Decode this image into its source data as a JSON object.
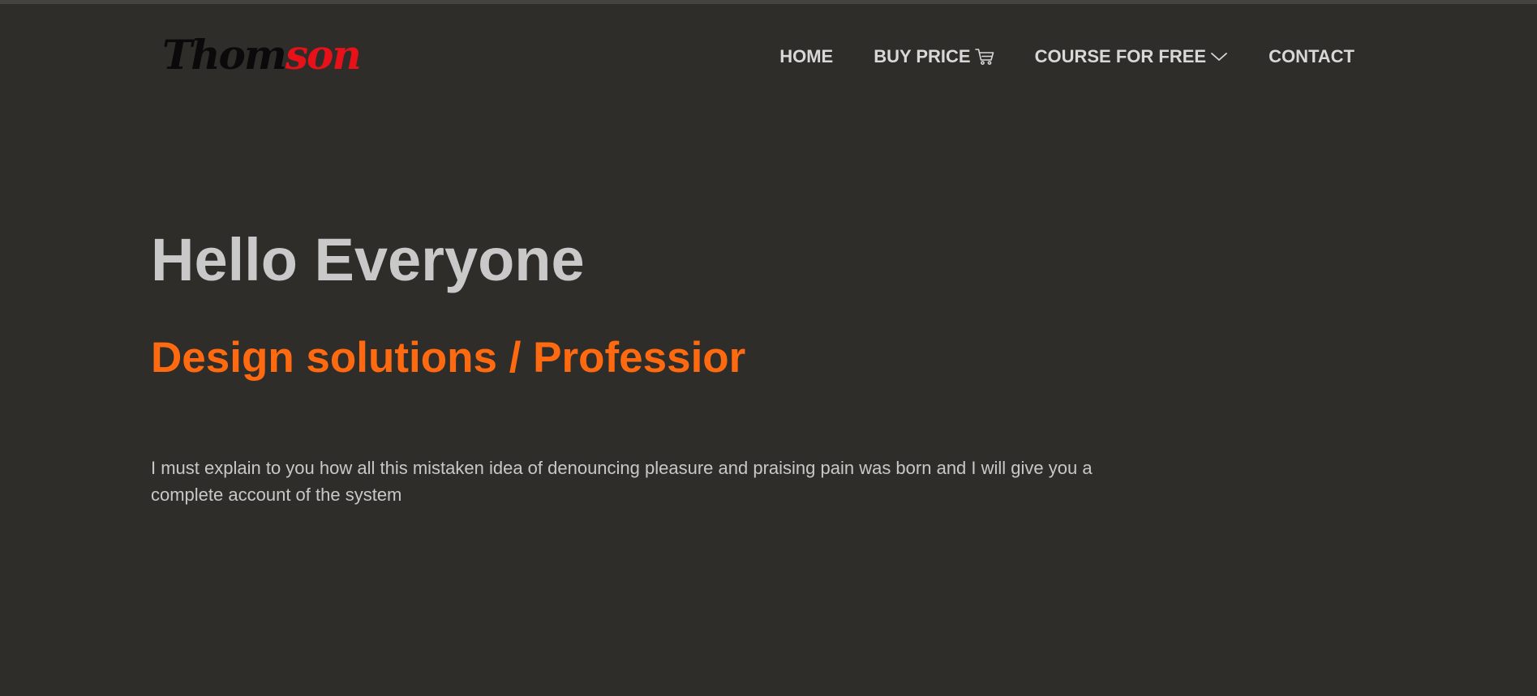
{
  "brand": {
    "logo_part1": "Thom",
    "logo_part2": "son"
  },
  "nav": {
    "home": "HOME",
    "buy_price": "BUY PRICE",
    "course_for_free": "COURSE FOR FREE",
    "contact": "CONTACT",
    "buy_price_icon": "cart-icon",
    "course_icon": "chevron-down-icon"
  },
  "hero": {
    "title": "Hello Everyone",
    "subtitle": "Design solutions / Professior",
    "text": "I must explain to you how all this mistaken idea of denouncing pleasure and praising pain was born and I will give you a complete account of the system"
  },
  "colors": {
    "background": "#2f2d29",
    "accent": "#ff6a10",
    "logo_red": "#e8111a",
    "text_light": "#c9c9c9"
  }
}
